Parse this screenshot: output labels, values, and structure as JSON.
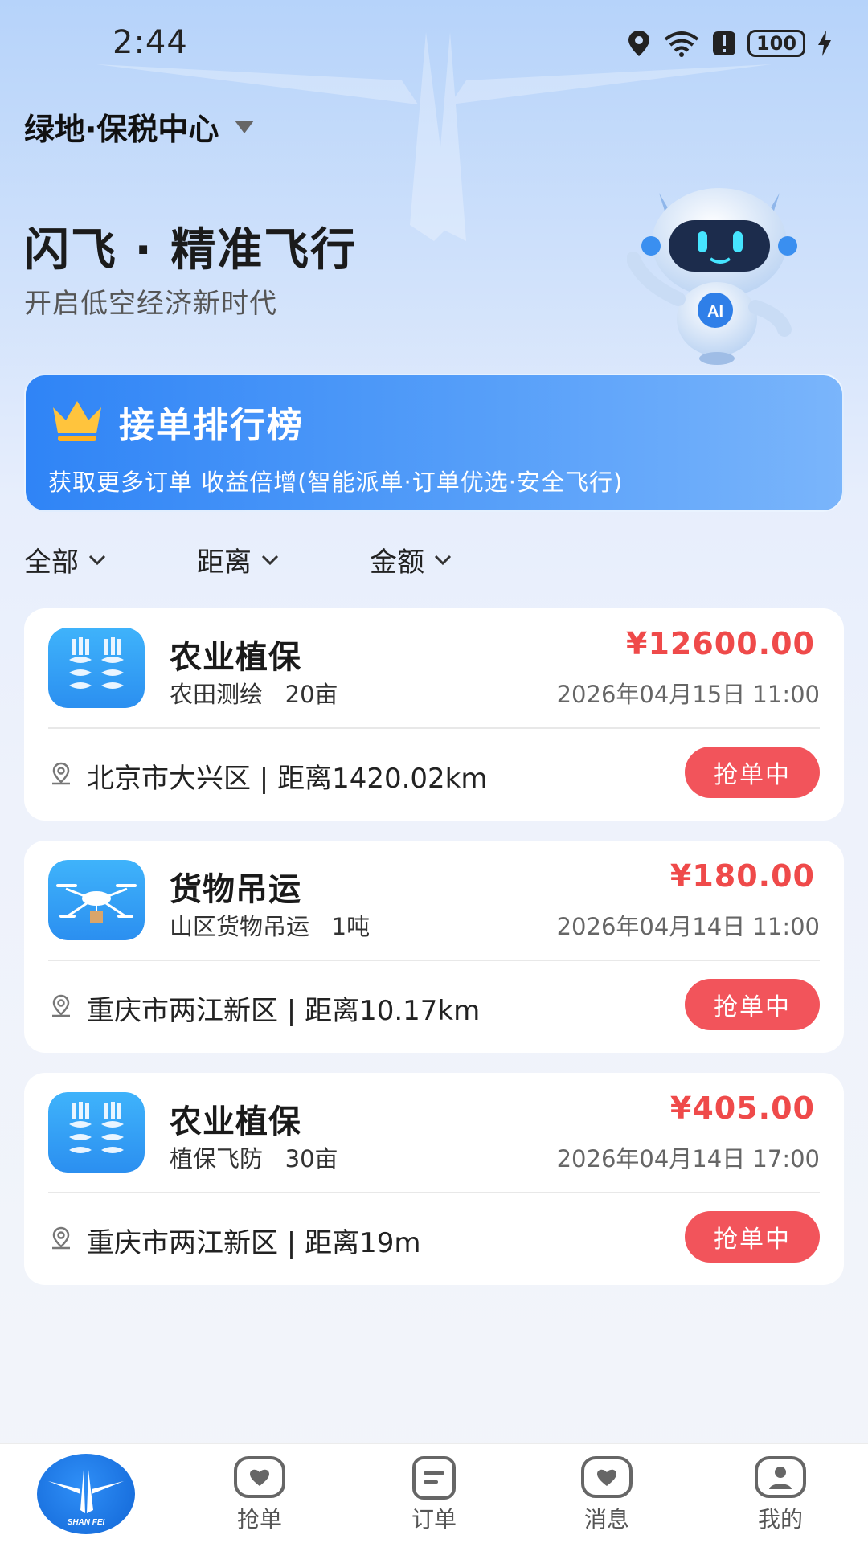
{
  "status_bar": {
    "time": "2:44",
    "battery": "100"
  },
  "location": {
    "name": "绿地·保税中心"
  },
  "hero": {
    "title": "闪飞 · 精准飞行",
    "subtitle": "开启低空经济新时代"
  },
  "ranking": {
    "title": "接单排行榜",
    "description": "获取更多订单 收益倍增(智能派单·订单优选·安全飞行)"
  },
  "filters": [
    {
      "label": "全部"
    },
    {
      "label": "距离"
    },
    {
      "label": "金额"
    }
  ],
  "orders": [
    {
      "icon": "wheat-icon",
      "title": "农业植保",
      "subtitle": "农田测绘   20亩",
      "price": "¥12600.00",
      "time": "2026年04月15日 11:00",
      "location": "北京市大兴区 | 距离1420.02km",
      "button": "抢单中"
    },
    {
      "icon": "drone-icon",
      "title": "货物吊运",
      "subtitle": "山区货物吊运   1吨",
      "price": "¥180.00",
      "time": "2026年04月14日 11:00",
      "location": "重庆市两江新区 | 距离10.17km",
      "button": "抢单中"
    },
    {
      "icon": "wheat-icon",
      "title": "农业植保",
      "subtitle": "植保飞防   30亩",
      "price": "¥405.00",
      "time": "2026年04月14日 17:00",
      "location": "重庆市两江新区 | 距离19m",
      "button": "抢单中"
    }
  ],
  "bottom_nav": {
    "home_logo_text": "SHAN FEI",
    "items": [
      {
        "label": "抢单",
        "icon": "heart-chat-icon"
      },
      {
        "label": "订单",
        "icon": "document-icon"
      },
      {
        "label": "消息",
        "icon": "heart-chat-icon"
      },
      {
        "label": "我的",
        "icon": "user-icon"
      }
    ]
  },
  "colors": {
    "accent": "#2f84f6",
    "price": "#ef4a4a",
    "button": "#f2545b"
  }
}
